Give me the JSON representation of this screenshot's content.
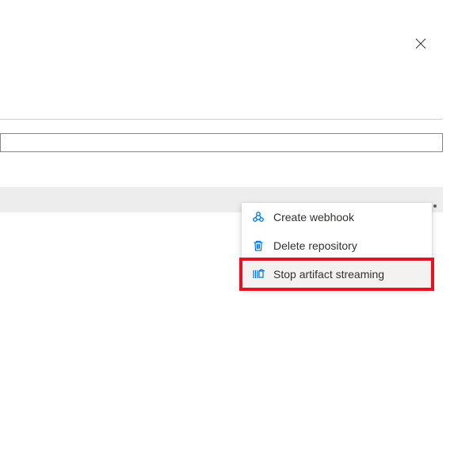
{
  "colors": {
    "accent": "#0078d4",
    "danger": "#e81123",
    "text": "#323130"
  },
  "menu": {
    "items": [
      {
        "label": "Create webhook",
        "icon": "webhook-icon"
      },
      {
        "label": "Delete repository",
        "icon": "delete-icon"
      },
      {
        "label": "Stop artifact streaming",
        "icon": "stop-streaming-icon"
      }
    ]
  }
}
